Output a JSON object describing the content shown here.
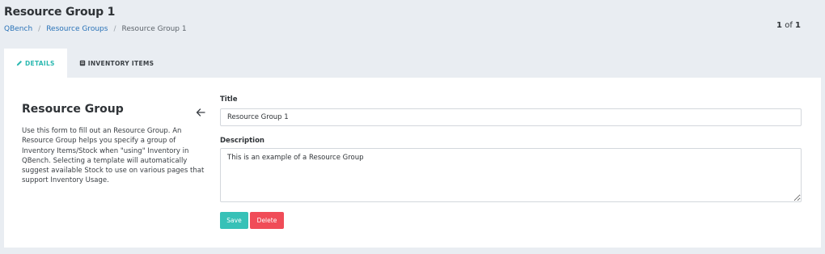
{
  "header": {
    "title": "Resource Group 1",
    "pager_current": "1",
    "pager_sep": "of",
    "pager_total": "1"
  },
  "breadcrumb": {
    "items": [
      "QBench",
      "Resource Groups"
    ],
    "current": "Resource Group 1",
    "separator": "/"
  },
  "tabs": [
    {
      "label": "DETAILS",
      "icon": "pencil-icon",
      "active": true
    },
    {
      "label": "INVENTORY ITEMS",
      "icon": "inventory-icon",
      "active": false
    }
  ],
  "sidebar": {
    "title": "Resource Group",
    "description": "Use this form to fill out an Resource Group. An Resource Group helps you specify a group of Inventory Items/Stock when \"using\" Inventory in QBench. Selecting a template will automatically suggest available Stock to use on various pages that support Inventory Usage.",
    "back_icon": "arrow-left-icon"
  },
  "form": {
    "title_label": "Title",
    "title_value": "Resource Group 1",
    "description_label": "Description",
    "description_value": "This is an example of a Resource Group"
  },
  "actions": {
    "save_label": "Save",
    "delete_label": "Delete"
  },
  "colors": {
    "accent": "#37c1b7",
    "danger": "#f04c58",
    "link": "#2a73b8",
    "background": "#e9edf2"
  }
}
